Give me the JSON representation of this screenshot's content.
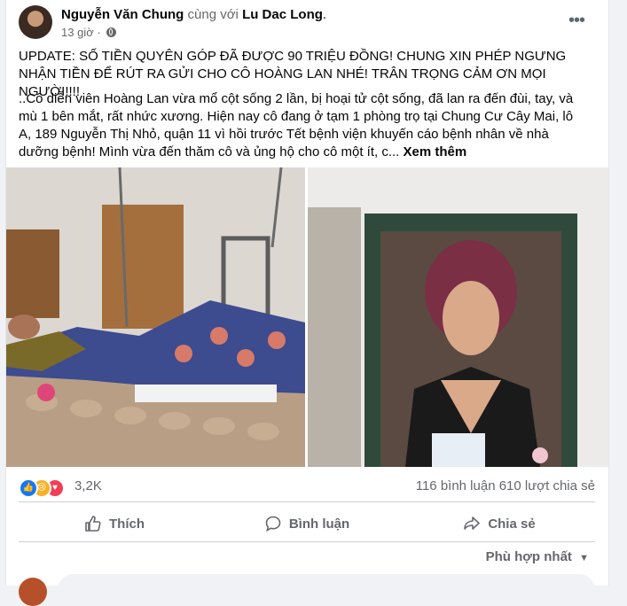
{
  "post": {
    "author": "Nguyễn Văn Chung",
    "with_text": "cùng với",
    "tagged": "Lu Dac Long",
    "tagged_suffix": ".",
    "time": "13 giờ",
    "dot": "·",
    "update_text": "UPDATE: SỐ TIỀN QUYÊN GÓP ĐÃ ĐƯỢC 90 TRIỆU ĐỒNG! CHUNG XIN PHÉP NGƯNG NHẬN TIỀN ĐỂ RÚT RA GỬI CHO CÔ HOÀNG LAN NHÉ! TRÂN TRỌNG CẢM ƠN MỌI NGƯỜI!!!!",
    "body_text": "..Cô diễn viên Hoàng Lan vừa mổ cột sống 2 lần, bị hoại tử cột sống, đã lan ra đến đùi, tay, và mù 1 bên mắt, rất nhức xương. Hiện nay cô đang ở tạm 1 phòng trọ tại Chung Cư Cây Mai, lô A, 189 Nguyễn Thị Nhỏ, quận 11 vì hồi trước Tết bệnh viện khuyến cáo bệnh nhân về nhà dưỡng bệnh! Mình vừa đến thăm cô và ủng hộ cho cô một ít, c...",
    "see_more": "Xem thêm"
  },
  "stats": {
    "reactions": [
      "like",
      "sad",
      "love"
    ],
    "reaction_count": "3,2K",
    "comments": "116 bình luận",
    "shares": "610 lượt chia sẻ"
  },
  "actions": {
    "like": "Thích",
    "comment": "Bình luận",
    "share": "Chia sẻ"
  },
  "sort_label": "Phù hợp nhất",
  "colors": {
    "like": "#1877f2",
    "sad": "#f7b125",
    "love": "#f33e58",
    "muted": "#65676b"
  }
}
